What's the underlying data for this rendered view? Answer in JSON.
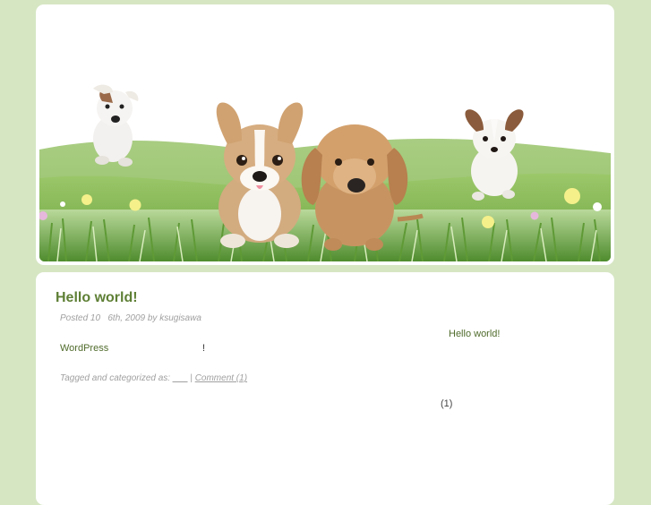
{
  "header": {
    "banner_image": "puppies-on-grass-hill-illustration"
  },
  "post": {
    "title": "Hello world!",
    "meta": "Posted 10   6th, 2009 by ksugisawa",
    "body_link": "WordPress",
    "body_excl": "!",
    "footer_prefix": "Tagged and categorized as: ",
    "footer_tag": "___",
    "footer_separator": " | ",
    "footer_comment": "Comment (1)"
  },
  "sidebar": {
    "recent_post": "Hello world!",
    "comment_count": "(1)"
  },
  "colors": {
    "page_bg": "#d6e6c3",
    "title": "#5e7f35",
    "link": "#4f6b2b",
    "meta": "#a0a0a0"
  }
}
